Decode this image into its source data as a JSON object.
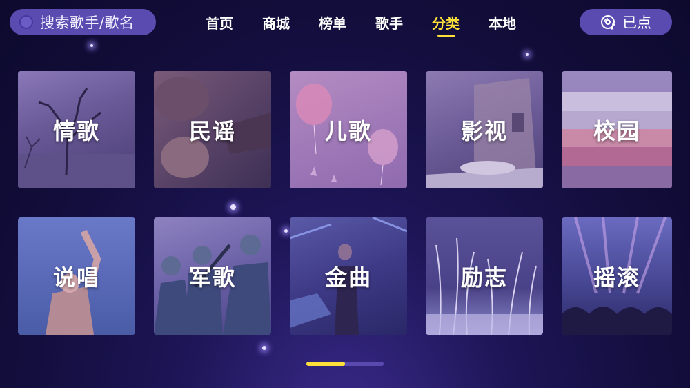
{
  "search": {
    "placeholder": "搜索歌手/歌名",
    "icon": "search-icon"
  },
  "nav": {
    "items": [
      {
        "label": "首页"
      },
      {
        "label": "商城"
      },
      {
        "label": "榜单"
      },
      {
        "label": "歌手"
      },
      {
        "label": "分类",
        "active": true
      },
      {
        "label": "本地"
      }
    ]
  },
  "ordered_button": {
    "label": "已点",
    "icon": "disc-icon"
  },
  "categories": [
    {
      "label": "情歌"
    },
    {
      "label": "民谣"
    },
    {
      "label": "儿歌"
    },
    {
      "label": "影视"
    },
    {
      "label": "校园"
    },
    {
      "label": "说唱"
    },
    {
      "label": "军歌"
    },
    {
      "label": "金曲"
    },
    {
      "label": "励志"
    },
    {
      "label": "摇滚"
    }
  ],
  "pager": {
    "current_page": 1,
    "total_pages": 2
  },
  "colors": {
    "accent": "#ffe03a",
    "pill": "#5a4bb0",
    "background": "#120d3a"
  }
}
